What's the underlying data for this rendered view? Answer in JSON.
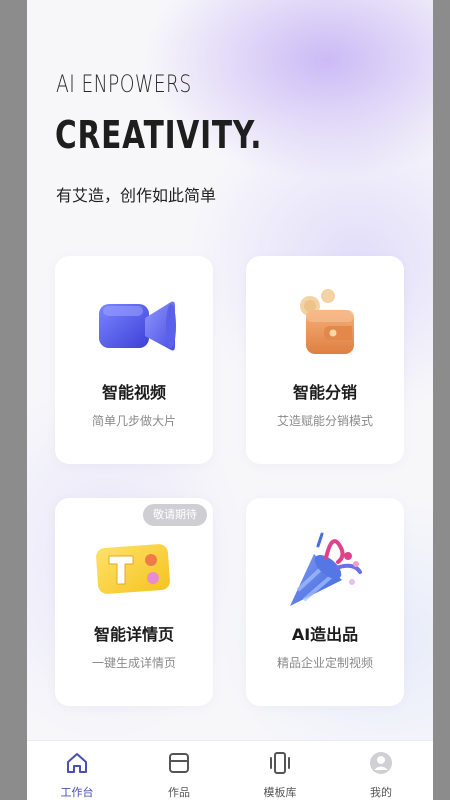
{
  "hero": {
    "subtitle": "AI ENPOWERS",
    "title": "CREATIVITY.",
    "slogan": "有艾造，创作如此简单"
  },
  "cards": [
    {
      "title": "智能视频",
      "desc": "简单几步做大片",
      "icon": "video-camera-icon"
    },
    {
      "title": "智能分销",
      "desc": "艾造赋能分销模式",
      "icon": "wallet-coins-icon"
    },
    {
      "title": "智能详情页",
      "desc": "一键生成详情页",
      "icon": "t-block-icon",
      "badge": "敬请期待"
    },
    {
      "title": "AI造出品",
      "desc": "精品企业定制视频",
      "icon": "party-popper-icon"
    }
  ],
  "tabbar": {
    "items": [
      {
        "label": "工作台",
        "icon": "home-icon",
        "active": true
      },
      {
        "label": "作品",
        "icon": "works-icon",
        "active": false
      },
      {
        "label": "模板库",
        "icon": "template-icon",
        "active": false
      },
      {
        "label": "我的",
        "icon": "profile-icon",
        "active": false
      }
    ]
  },
  "colors": {
    "accent": "#4a4fb3",
    "background_glow": "#c4b0f5",
    "badge_bg": "#cfcfd3"
  }
}
